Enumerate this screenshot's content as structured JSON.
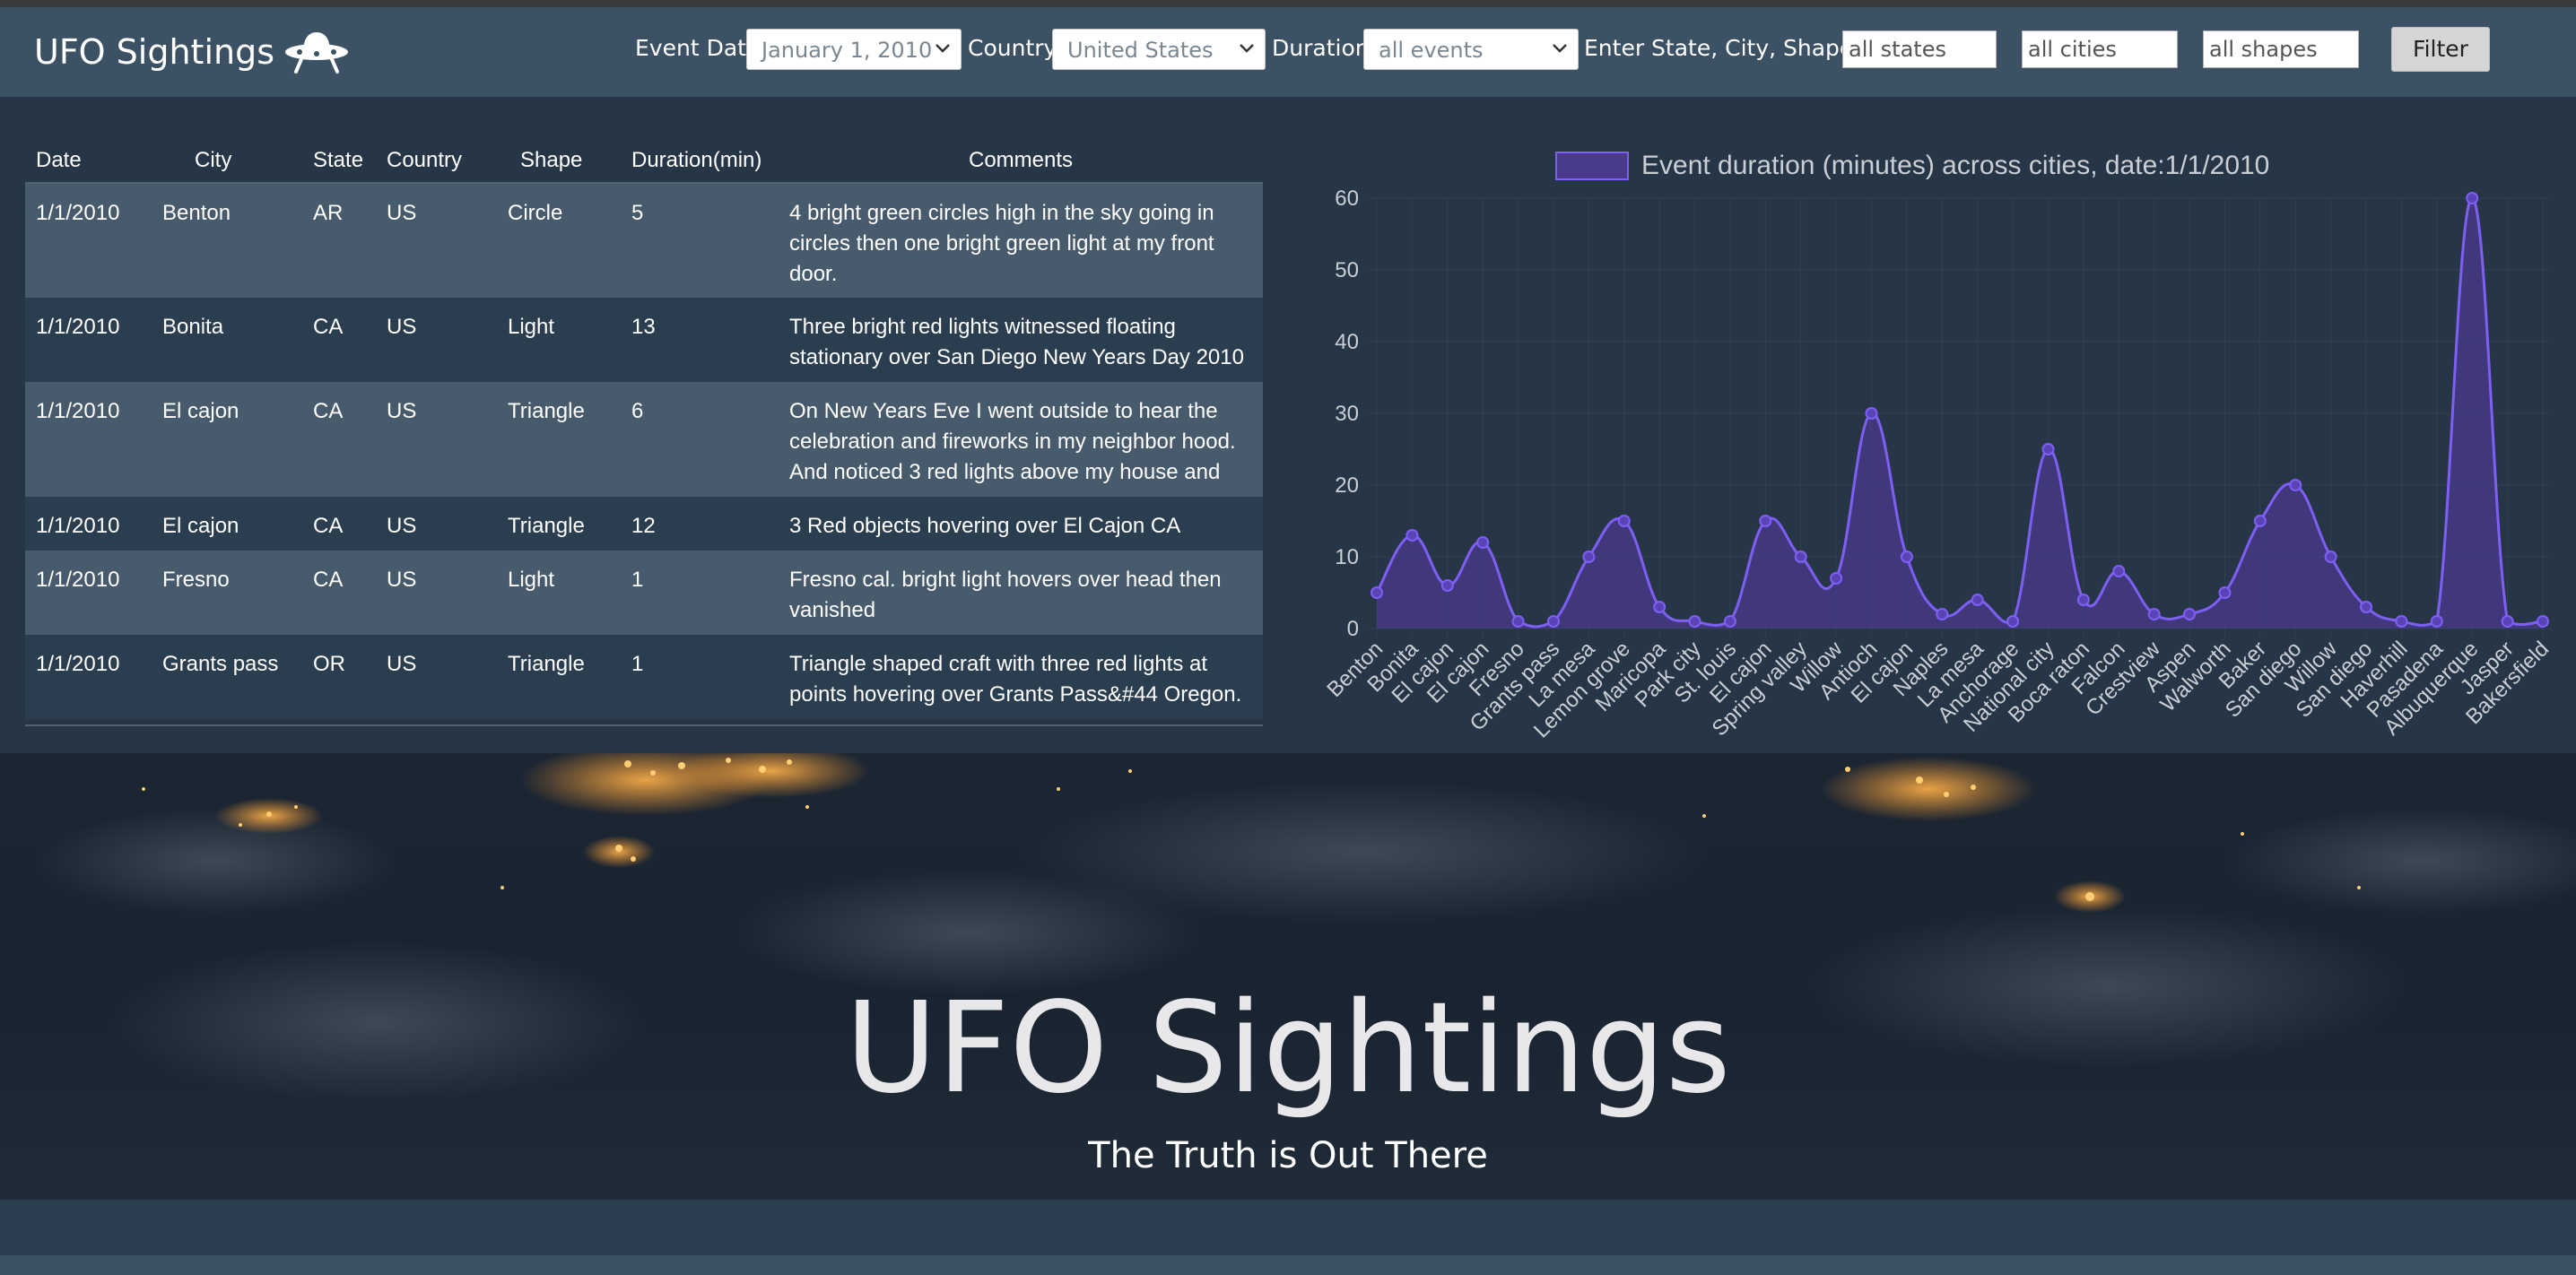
{
  "nav": {
    "brand": "UFO Sightings",
    "brand_icon": "ufo-icon",
    "filters": {
      "event_date_label": "Event Date",
      "event_date_value": "January 1, 2010",
      "country_label": "Country",
      "country_value": "United States",
      "duration_label": "Duration",
      "duration_value": "all events",
      "text_filter_label": "Enter State, City, Shape:",
      "state_placeholder": "all states",
      "city_placeholder": "all cities",
      "shape_placeholder": "all shapes",
      "filter_button": "Filter"
    }
  },
  "table": {
    "headers": [
      "Date",
      "City",
      "State",
      "Country",
      "Shape",
      "Duration(min)",
      "Comments"
    ],
    "rows": [
      {
        "date": "1/1/2010",
        "city": "Benton",
        "state": "AR",
        "country": "US",
        "shape": "Circle",
        "duration": "5",
        "comment": "4 bright green circles high in the sky going in circles then one bright green light at my front door."
      },
      {
        "date": "1/1/2010",
        "city": "Bonita",
        "state": "CA",
        "country": "US",
        "shape": "Light",
        "duration": "13",
        "comment": "Three bright red lights witnessed floating stationary over San Diego New Years Day 2010"
      },
      {
        "date": "1/1/2010",
        "city": "El cajon",
        "state": "CA",
        "country": "US",
        "shape": "Triangle",
        "duration": "6",
        "comment": "On New Years Eve I went outside to hear the celebration and fireworks in my neighbor hood. And noticed 3 red lights above my house and"
      },
      {
        "date": "1/1/2010",
        "city": "El cajon",
        "state": "CA",
        "country": "US",
        "shape": "Triangle",
        "duration": "12",
        "comment": "3 Red objects hovering over El Cajon CA"
      },
      {
        "date": "1/1/2010",
        "city": "Fresno",
        "state": "CA",
        "country": "US",
        "shape": "Light",
        "duration": "1",
        "comment": "Fresno cal. bright light hovers over head then vanished"
      },
      {
        "date": "1/1/2010",
        "city": "Grants pass",
        "state": "OR",
        "country": "US",
        "shape": "Triangle",
        "duration": "1",
        "comment": "Triangle shaped craft with three red lights at points hovering over Grants Pass&#44 Oregon."
      }
    ]
  },
  "chart_data": {
    "type": "area",
    "title": "Event duration (minutes) across cities, date:1/1/2010",
    "legend": [
      "Event duration (minutes) across cities, date:1/1/2010"
    ],
    "legend_position": "top",
    "ylim": [
      0,
      60
    ],
    "yticks": [
      0,
      10,
      20,
      30,
      40,
      50,
      60
    ],
    "grid": true,
    "categories": [
      "Benton",
      "Bonita",
      "El cajon",
      "El cajon",
      "Fresno",
      "Grants pass",
      "La mesa",
      "Lemon grove",
      "Maricopa",
      "Park city",
      "St. louis",
      "El cajon",
      "Spring valley",
      "Willow",
      "Antioch",
      "El cajon",
      "Naples",
      "La mesa",
      "Anchorage",
      "National city",
      "Boca raton",
      "Falcon",
      "Crestview",
      "Aspen",
      "Walworth",
      "Baker",
      "San diego",
      "Willow",
      "San diego",
      "Haverhill",
      "Pasadena",
      "Albuquerque",
      "Jasper",
      "Bakersfield"
    ],
    "series": [
      {
        "name": "Event duration (minutes) across cities, date:1/1/2010",
        "values": [
          5,
          13,
          6,
          12,
          1,
          1,
          10,
          15,
          3,
          1,
          1,
          15,
          10,
          7,
          30,
          10,
          2,
          4,
          1,
          25,
          4,
          8,
          2,
          2,
          5,
          15,
          20,
          10,
          3,
          1,
          1,
          60,
          1,
          1
        ]
      }
    ],
    "colors": {
      "line": "#7e5ff5",
      "fill": "#4a3a8c",
      "grid": "#2f4152",
      "text": "#c9cfd5"
    }
  },
  "hero": {
    "title": "UFO Sightings",
    "subtitle": "The Truth is Out There"
  }
}
